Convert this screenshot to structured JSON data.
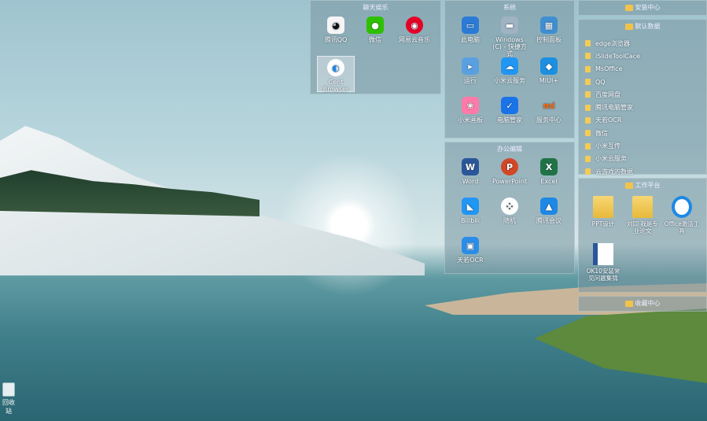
{
  "panels": {
    "social": {
      "title": "聊天娱乐",
      "apps": [
        {
          "label": "腾讯QQ",
          "icon": "qq-icon",
          "color": "#111111"
        },
        {
          "label": "微信",
          "icon": "wechat-icon",
          "color": "#2dc100"
        },
        {
          "label": "网易云音乐",
          "icon": "netease-music-icon",
          "color": "#e60026"
        },
        {
          "label": "Cent Browser",
          "icon": "cent-browser-icon",
          "color": "#1e88e5"
        }
      ]
    },
    "system": {
      "title": "系统",
      "apps": [
        {
          "label": "此电脑",
          "icon": "computer-icon",
          "color": "#2b7bd6"
        },
        {
          "label": "Windows (C) - 快捷方式",
          "icon": "drive-icon",
          "color": "#7f97a8"
        },
        {
          "label": "控制面板",
          "icon": "control-panel-icon",
          "color": "#3f8fd2"
        },
        {
          "label": "运行",
          "icon": "run-icon",
          "color": "#5aa0e0"
        },
        {
          "label": "小米云服务",
          "icon": "mi-cloud-icon",
          "color": "#2196f3"
        },
        {
          "label": "MIUI+",
          "icon": "miui-plus-icon",
          "color": "#1c8fe0"
        },
        {
          "label": "小米画板",
          "icon": "mi-draw-icon",
          "color": "#ff7aa8"
        },
        {
          "label": "电脑管家",
          "icon": "pc-manager-icon",
          "color": "#1a73e8"
        },
        {
          "label": "服务中心",
          "icon": "mi-service-icon",
          "color": "#ff6700"
        }
      ]
    },
    "office": {
      "title": "办公编辑",
      "apps": [
        {
          "label": "Word",
          "icon": "word-icon",
          "color": "#2b579a"
        },
        {
          "label": "PowerPoint",
          "icon": "powerpoint-icon",
          "color": "#d24726"
        },
        {
          "label": "Excel",
          "icon": "excel-icon",
          "color": "#217346"
        },
        {
          "label": "Bilibili",
          "icon": "bilibili-icon",
          "color": "#2196f3"
        },
        {
          "label": "随机",
          "icon": "random-icon",
          "color": "#ffffff"
        },
        {
          "label": "腾讯会议",
          "icon": "tencent-meeting-icon",
          "color": "#1e88e5"
        },
        {
          "label": "天若OCR",
          "icon": "ocr-icon",
          "color": "#2a8ee8"
        }
      ]
    },
    "install": {
      "title": "安装中心"
    },
    "default_data": {
      "title": "默认数据",
      "folders": [
        "edge浏览器",
        "iSlideToolCace",
        "MsOffice",
        "QQ",
        "百度网盘",
        "腾讯电脑管家",
        "天若OCR",
        "微信",
        "小米互传",
        "小米云服务",
        "云游戏的数据"
      ]
    },
    "work": {
      "title": "工作平台",
      "items": [
        {
          "label": "PPT设计",
          "icon": "folder-icon"
        },
        {
          "label": "刘同 我是专业论文",
          "icon": "folder-icon"
        },
        {
          "label": "Office激活工具",
          "icon": "office-icon"
        },
        {
          "label": "OK10安装常见问题集锦",
          "icon": "word-doc-icon"
        }
      ]
    },
    "collect": {
      "title": "收藏中心"
    }
  },
  "desktop": {
    "recycle_label": "回收站"
  }
}
